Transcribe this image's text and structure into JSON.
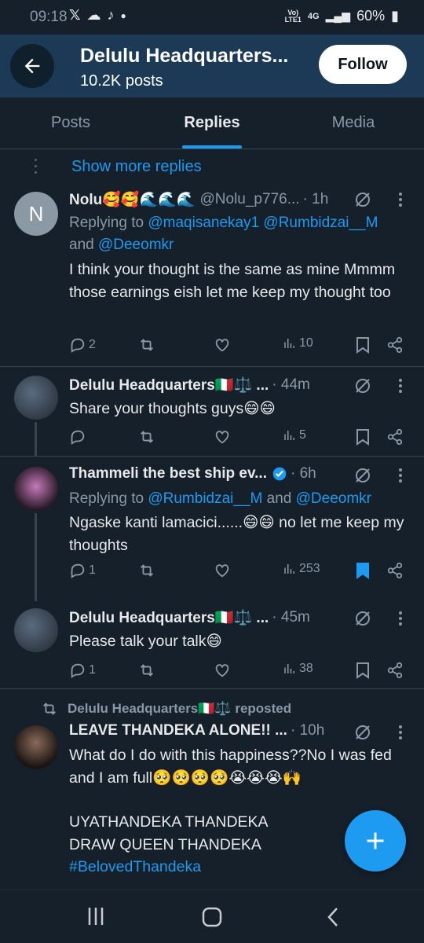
{
  "status_bar": {
    "time": "09:18",
    "battery": "60%",
    "network_top": "Vo)",
    "network_bottom": "LTE1",
    "net_type": "4G"
  },
  "header": {
    "title": "Delulu Headquarters...",
    "subtitle": "10.2K posts",
    "follow_label": "Follow"
  },
  "tabs": [
    "Posts",
    "Replies",
    "Media"
  ],
  "active_tab": "Replies",
  "feed": {
    "show_more": "Show more replies",
    "tweets": [
      {
        "name": "Nolu🥰🥰🌊🌊🌊",
        "handle": "@Nolu_p776...",
        "time": "· 1h",
        "replying_prefix": "Replying to",
        "replying_links": "@maqisanekay1 @Rumbidzai__M",
        "replying_and": "and",
        "replying_last": "@Deeomkr",
        "text": "I think your thought is the same as mine Mmmm those earnings eish let me keep my thought too",
        "replies": "2",
        "views": "10"
      },
      {
        "name": "Delulu Headquarters🇮🇹⚖️ ...",
        "time": "· 44m",
        "text": "Share your thoughts guys😄😄",
        "replies": "",
        "views": "5"
      },
      {
        "name": "Thammeli the best ship ev...",
        "verified": true,
        "time": "· 6h",
        "replying_prefix": "Replying to",
        "replying_links": "@Rumbidzai__M",
        "replying_and": "and",
        "replying_last": "@Deeomkr",
        "text": "Ngaske kanti lamacici......😄😄 no let me keep my thoughts",
        "replies": "1",
        "views": "253",
        "bookmarked": true
      },
      {
        "name": "Delulu Headquarters🇮🇹⚖️ ...",
        "time": "· 45m",
        "text": "Please talk your talk😄",
        "replies": "1",
        "views": "38"
      },
      {
        "repost_label": "Delulu Headquarters🇮🇹⚖️ reposted",
        "name": "LEAVE THANDEKA ALONE!! ...",
        "time": "· 10h",
        "text_line1": "What do I do with this happiness??No I was fed and I am full🥺🥺🥺🥺😭😭😭🙌",
        "text_line2": "UYATHANDEKA THANDEKA",
        "text_line3": "DRAW QUEEN THANDEKA",
        "hashtag": "#BelovedThandeka"
      }
    ]
  },
  "colors": {
    "background": "#15202b",
    "header_bg": "#1c3a55",
    "accent": "#1d9bf0",
    "muted": "#8b98a5"
  },
  "icons": {
    "status": [
      "x-logo-icon",
      "cloud-icon",
      "tiktok-icon",
      "dot-icon",
      "signal-icon",
      "battery-icon"
    ],
    "header": [
      "back-arrow-icon"
    ],
    "actions": [
      "reply-icon",
      "repost-icon",
      "like-icon",
      "views-icon",
      "bookmark-icon",
      "share-icon"
    ],
    "nav": [
      "recents-icon",
      "home-icon",
      "back-icon"
    ],
    "fab": "plus-icon"
  }
}
